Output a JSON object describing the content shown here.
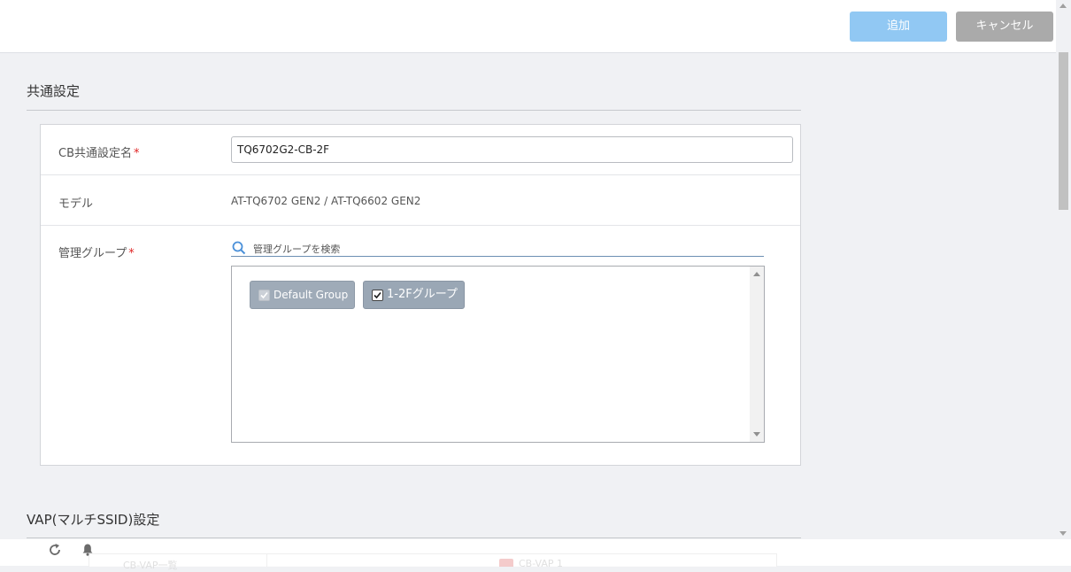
{
  "header": {
    "add_label": "追加",
    "cancel_label": "キャンセル"
  },
  "common": {
    "section_title": "共通設定",
    "cb_name_label": "CB共通設定名",
    "required_mark": "*",
    "cb_name_value": "TQ6702G2-CB-2F",
    "model_label": "モデル",
    "model_value": "AT-TQ6702 GEN2 / AT-TQ6602 GEN2",
    "group_label": "管理グループ",
    "group_search_placeholder": "管理グループを検索",
    "groups": [
      {
        "label": "Default Group",
        "checked": true,
        "disabled": true
      },
      {
        "label": "1-2Fグループ",
        "checked": true,
        "disabled": false
      }
    ]
  },
  "vap": {
    "section_title": "VAP(マルチSSID)設定",
    "tabs": [
      "CB-VAP一覧",
      "CB-VAP 1"
    ]
  },
  "footer": {
    "icons": [
      "refresh-icon",
      "bell-icon"
    ]
  },
  "colors": {
    "add_button": "#91c8f3",
    "cancel_button": "#aaaaaa",
    "chip": "#9aa7b5",
    "required": "#e02424"
  }
}
